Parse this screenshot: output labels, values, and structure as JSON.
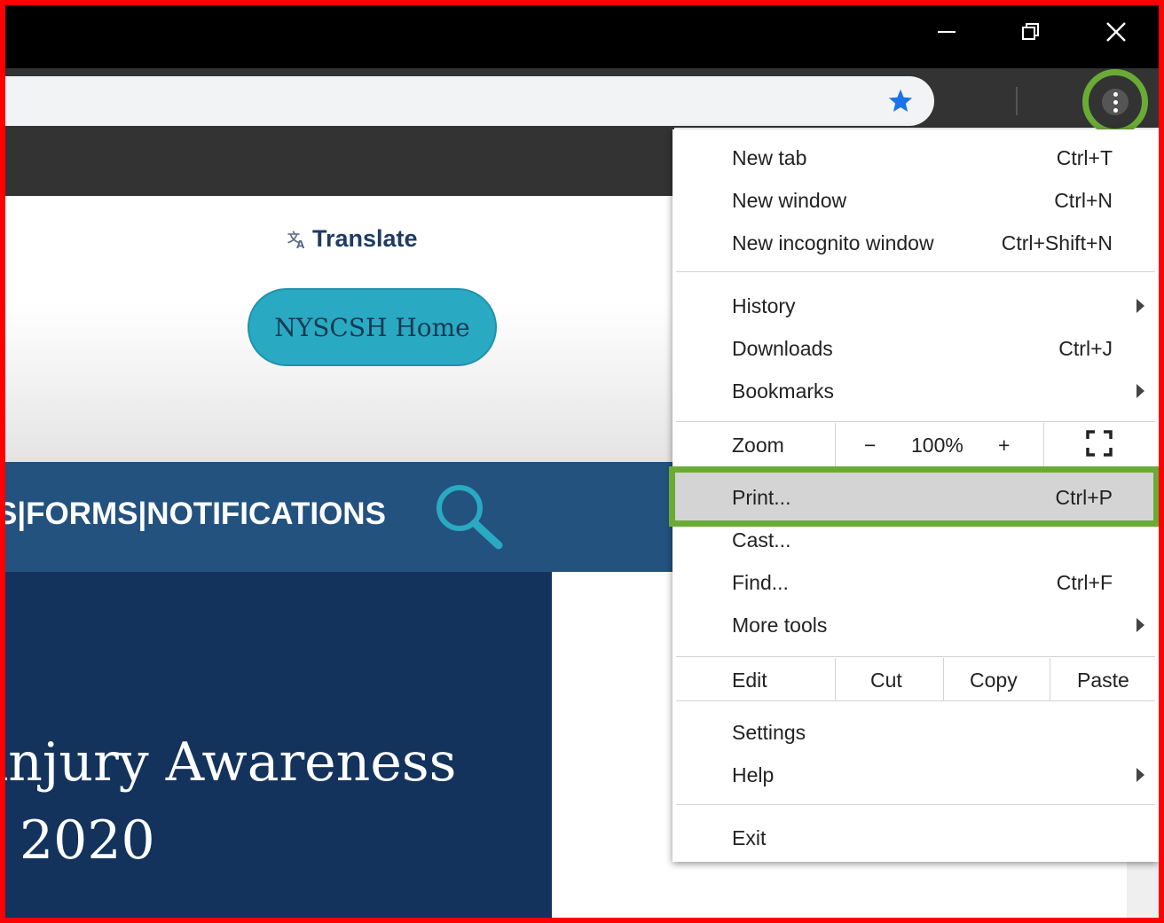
{
  "window": {
    "minimize_label": "Minimize",
    "restore_label": "Restore",
    "close_label": "Close"
  },
  "page": {
    "translate": "Translate",
    "home_button": "NYSCSH Home",
    "nav_text": "S|FORMS|NOTIFICATIONS",
    "hero_line1": "injury Awareness",
    "hero_line2": "2020"
  },
  "menu": {
    "new_tab": {
      "label": "New tab",
      "shortcut": "Ctrl+T"
    },
    "new_window": {
      "label": "New window",
      "shortcut": "Ctrl+N"
    },
    "new_incognito": {
      "label": "New incognito window",
      "shortcut": "Ctrl+Shift+N"
    },
    "history": {
      "label": "History"
    },
    "downloads": {
      "label": "Downloads",
      "shortcut": "Ctrl+J"
    },
    "bookmarks": {
      "label": "Bookmarks"
    },
    "zoom": {
      "label": "Zoom",
      "minus": "−",
      "value": "100%",
      "plus": "+"
    },
    "print": {
      "label": "Print...",
      "shortcut": "Ctrl+P"
    },
    "cast": {
      "label": "Cast..."
    },
    "find": {
      "label": "Find...",
      "shortcut": "Ctrl+F"
    },
    "more_tools": {
      "label": "More tools"
    },
    "edit": {
      "label": "Edit",
      "cut": "Cut",
      "copy": "Copy",
      "paste": "Paste"
    },
    "settings": {
      "label": "Settings"
    },
    "help": {
      "label": "Help"
    },
    "exit": {
      "label": "Exit"
    }
  },
  "colors": {
    "highlight": "#6aab35",
    "frame": "#ff0000",
    "navbar": "#23527f",
    "hero": "#13335d",
    "home_button": "#2aa9c3"
  }
}
